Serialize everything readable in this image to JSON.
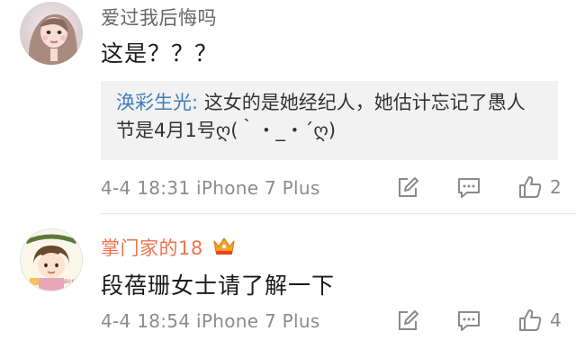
{
  "comments": [
    {
      "username": "爱过我后悔吗",
      "text": "这是？？？",
      "reply": {
        "author": "涣彩生光:",
        "text": " 这女的是她经纪人，她估计忘记了愚人节是4月1号ღ(｀・_・´ღ)"
      },
      "meta": "4-4 18:31  iPhone 7 Plus",
      "likes": "2",
      "icons": [
        "edit-icon",
        "message-icon",
        "thumbs-up-icon"
      ]
    },
    {
      "username": "掌门家的18",
      "badge_icon": "crown-badge-icon",
      "text": "段蓓珊女士请了解一下",
      "meta": "4-4 18:54  iPhone 7 Plus",
      "likes": "4",
      "icons": [
        "edit-icon",
        "message-icon",
        "thumbs-up-icon"
      ]
    }
  ],
  "colors": {
    "username_gray": "#666666",
    "username_orange": "#eb7350",
    "reply_author_blue": "#3f7dbd",
    "meta_gray": "#8c8c8c",
    "quote_bg": "#f2f2f2"
  }
}
